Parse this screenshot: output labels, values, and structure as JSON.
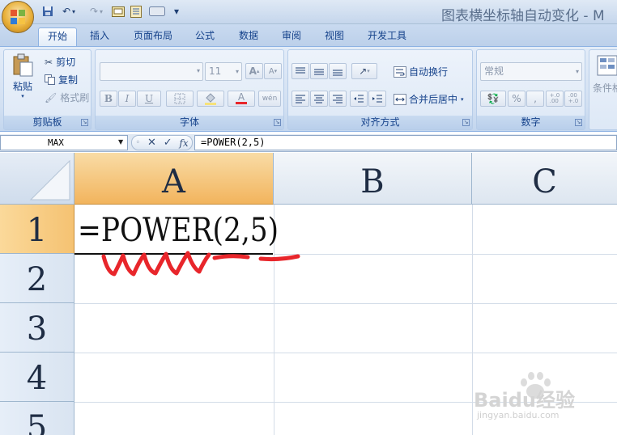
{
  "window": {
    "title": "图表横坐标轴自动变化 - M"
  },
  "quick_access": {
    "customize_glyph": "▾"
  },
  "tabs": [
    {
      "label": "开始",
      "active": true
    },
    {
      "label": "插入",
      "active": false
    },
    {
      "label": "页面布局",
      "active": false
    },
    {
      "label": "公式",
      "active": false
    },
    {
      "label": "数据",
      "active": false
    },
    {
      "label": "审阅",
      "active": false
    },
    {
      "label": "视图",
      "active": false
    },
    {
      "label": "开发工具",
      "active": false
    }
  ],
  "ribbon": {
    "clipboard": {
      "label": "剪贴板",
      "paste": "粘贴",
      "cut": "剪切",
      "copy": "复制",
      "format_painter": "格式刷"
    },
    "font": {
      "label": "字体",
      "font_name": "",
      "font_size": "11",
      "bold": "B",
      "italic": "I",
      "underline": "U",
      "grow": "A",
      "shrink": "A",
      "font_color": "A",
      "phonetic": "wén"
    },
    "alignment": {
      "label": "对齐方式",
      "wrap_text": "自动换行",
      "merge_center": "合并后居中"
    },
    "number": {
      "label": "数字",
      "format": "常规",
      "percent": "%",
      "comma": ",",
      "inc_decimal": "+.0\n.00",
      "dec_decimal": ".00\n+.0"
    },
    "styles": {
      "conditional": "条件格"
    }
  },
  "formula_bar": {
    "name_box": "MAX",
    "cancel_glyph": "✕",
    "enter_glyph": "✓",
    "fx": "fx",
    "formula": "=POWER(2,5)"
  },
  "sheet": {
    "columns": [
      "A",
      "B",
      "C"
    ],
    "rows": [
      "1",
      "2",
      "3",
      "4",
      "5"
    ],
    "selected_column": "A",
    "selected_row": "1",
    "cell_a1": "=POWER(2,5)"
  },
  "watermark": {
    "brand": "Baidu经验",
    "url": "jingyan.baidu.com"
  },
  "colors": {
    "accent_orange": "#f2b45d",
    "annotation_red": "#e8262b",
    "ribbon_text": "#15428b"
  }
}
